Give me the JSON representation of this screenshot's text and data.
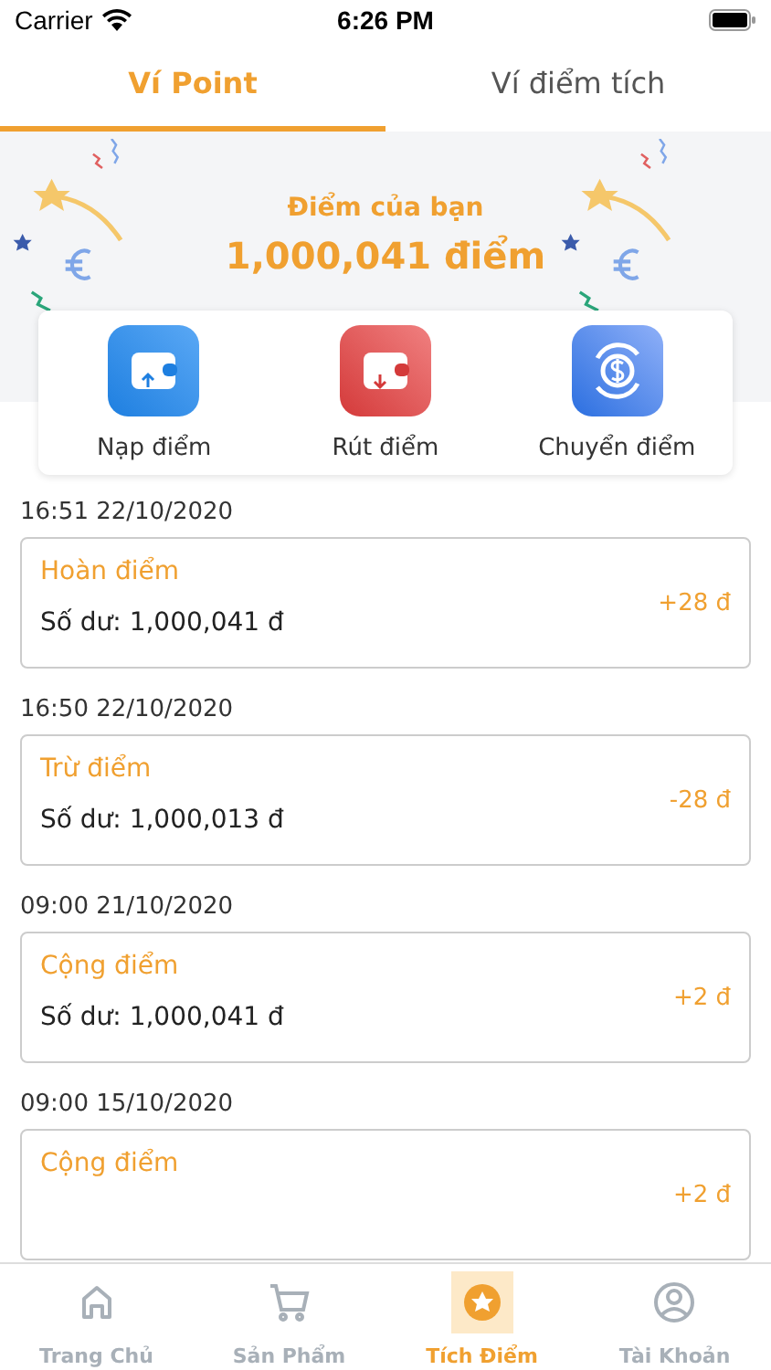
{
  "status_bar": {
    "carrier": "Carrier",
    "time": "6:26 PM"
  },
  "tabs": [
    {
      "label": "Ví Point",
      "selected": true
    },
    {
      "label": "Ví điểm tích",
      "selected": false
    }
  ],
  "balance": {
    "label": "Điểm của bạn",
    "value": "1,000,041 điểm"
  },
  "actions": [
    {
      "label": "Nạp điểm",
      "kind": "deposit"
    },
    {
      "label": "Rút điểm",
      "kind": "withdraw"
    },
    {
      "label": "Chuyển điểm",
      "kind": "transfer"
    }
  ],
  "transactions": [
    {
      "date": "16:51 22/10/2020",
      "title": "Hoàn điểm",
      "balance": "Số dư: 1,000,041 đ",
      "amount": "+28 đ"
    },
    {
      "date": "16:50 22/10/2020",
      "title": "Trừ điểm",
      "balance": "Số dư: 1,000,013 đ",
      "amount": "-28 đ"
    },
    {
      "date": "09:00 21/10/2020",
      "title": "Cộng điểm",
      "balance": "Số dư: 1,000,041 đ",
      "amount": "+2 đ"
    },
    {
      "date": "09:00 15/10/2020",
      "title": "Cộng điểm",
      "amount": "+2 đ"
    }
  ],
  "bottom_nav": [
    {
      "label": "Trang Chủ",
      "kind": "home",
      "selected": false
    },
    {
      "label": "Sản Phẩm",
      "kind": "cart",
      "selected": false
    },
    {
      "label": "Tích Điểm",
      "kind": "points",
      "selected": true
    },
    {
      "label": "Tài Khoản",
      "kind": "account",
      "selected": false
    }
  ]
}
